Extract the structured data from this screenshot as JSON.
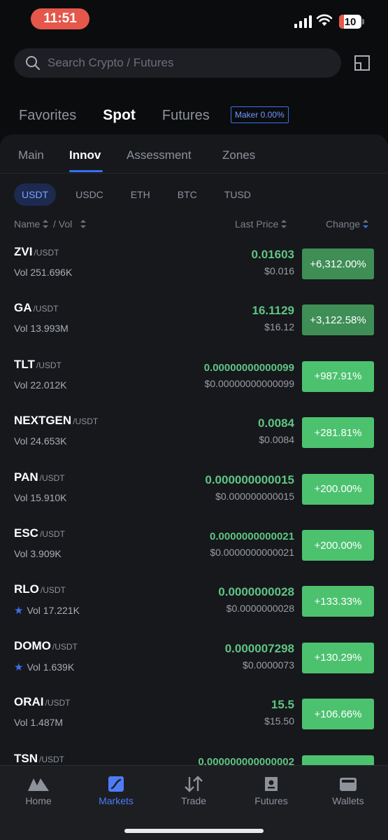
{
  "status": {
    "time": "11:51",
    "battery": "10"
  },
  "search": {
    "placeholder": "Search Crypto / Futures"
  },
  "top_tabs": {
    "favorites": "Favorites",
    "spot": "Spot",
    "futures": "Futures",
    "maker_badge": "Maker 0.00%"
  },
  "sub_tabs": {
    "main": "Main",
    "innov": "Innov",
    "assessment": "Assessment",
    "zones": "Zones"
  },
  "quotes": [
    "USDT",
    "USDC",
    "ETH",
    "BTC",
    "TUSD"
  ],
  "columns": {
    "name": "Name",
    "vol": "/ Vol",
    "last_price": "Last Price",
    "change": "Change"
  },
  "rows": [
    {
      "symbol": "ZVI",
      "quote": "/USDT",
      "vol": "Vol 251.696K",
      "price": "0.01603",
      "fiat": "$0.016",
      "change": "+6,312.00%",
      "favorite": false
    },
    {
      "symbol": "GA",
      "quote": "/USDT",
      "vol": "Vol 13.993M",
      "price": "16.1129",
      "fiat": "$16.12",
      "change": "+3,122.58%",
      "favorite": false
    },
    {
      "symbol": "TLT",
      "quote": "/USDT",
      "vol": "Vol 22.012K",
      "price": "0.00000000000099",
      "fiat": "$0.00000000000099",
      "change": "+987.91%",
      "favorite": false
    },
    {
      "symbol": "NEXTGEN",
      "quote": "/USDT",
      "vol": "Vol 24.653K",
      "price": "0.0084",
      "fiat": "$0.0084",
      "change": "+281.81%",
      "favorite": false
    },
    {
      "symbol": "PAN",
      "quote": "/USDT",
      "vol": "Vol 15.910K",
      "price": "0.000000000015",
      "fiat": "$0.000000000015",
      "change": "+200.00%",
      "favorite": false
    },
    {
      "symbol": "ESC",
      "quote": "/USDT",
      "vol": "Vol 3.909K",
      "price": "0.0000000000021",
      "fiat": "$0.0000000000021",
      "change": "+200.00%",
      "favorite": false
    },
    {
      "symbol": "RLO",
      "quote": "/USDT",
      "vol": "Vol 17.221K",
      "price": "0.0000000028",
      "fiat": "$0.0000000028",
      "change": "+133.33%",
      "favorite": true
    },
    {
      "symbol": "DOMO",
      "quote": "/USDT",
      "vol": "Vol 1.639K",
      "price": "0.000007298",
      "fiat": "$0.0000073",
      "change": "+130.29%",
      "favorite": true
    },
    {
      "symbol": "ORAI",
      "quote": "/USDT",
      "vol": "Vol 1.487M",
      "price": "15.5",
      "fiat": "$15.50",
      "change": "+106.66%",
      "favorite": false
    },
    {
      "symbol": "TSN",
      "quote": "/USDT",
      "vol": "",
      "price": "0.000000000000002",
      "fiat": "",
      "change": "",
      "favorite": false
    }
  ],
  "nav": {
    "home": "Home",
    "markets": "Markets",
    "trade": "Trade",
    "futures": "Futures",
    "wallets": "Wallets"
  },
  "colors": {
    "accent": "#3b6ff0",
    "gain": "#4cc26f",
    "gain_strong": "#3e8e56",
    "background": "#0b0c0e"
  }
}
